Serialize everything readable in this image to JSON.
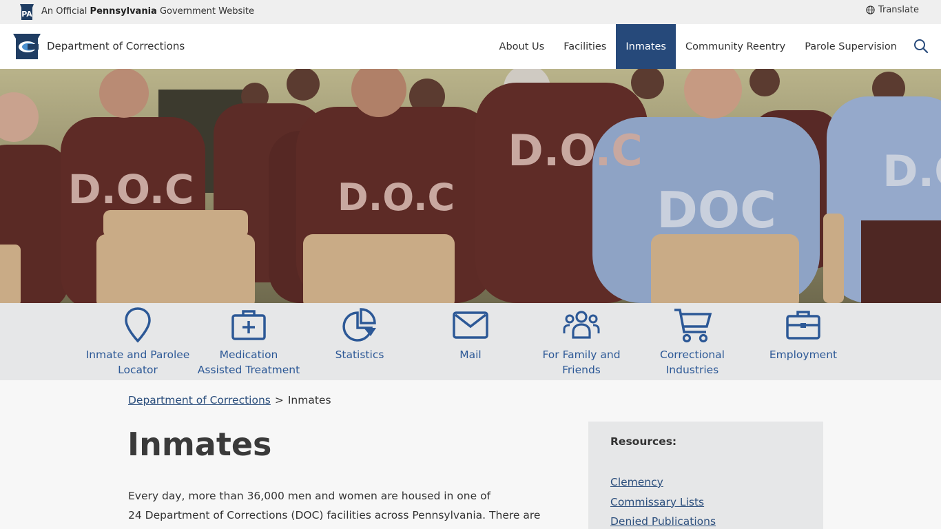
{
  "banner": {
    "official_prefix": "An Official ",
    "official_state": "Pennsylvania",
    "official_suffix": " Government Website",
    "badge_text": "PA",
    "translate": "Translate"
  },
  "header": {
    "department": "Department of Corrections",
    "nav": [
      {
        "label": "About Us"
      },
      {
        "label": "Facilities"
      },
      {
        "label": "Inmates",
        "active": true
      },
      {
        "label": "Community Reentry"
      },
      {
        "label": "Parole Supervision"
      }
    ]
  },
  "hero": {
    "shirt_labels": [
      "D.O.C",
      "D.O.C",
      "D.O.C",
      "DOC",
      "D.O"
    ]
  },
  "quicklinks": [
    {
      "line1": "Inmate and Parolee",
      "line2": "Locator",
      "icon": "map-pin-icon"
    },
    {
      "line1": "Medication",
      "line2": "Assisted Treatment",
      "icon": "medical-kit-icon"
    },
    {
      "line1": "Statistics",
      "line2": "",
      "icon": "pie-chart-icon"
    },
    {
      "line1": "Mail",
      "line2": "",
      "icon": "envelope-icon"
    },
    {
      "line1": "For Family and",
      "line2": "Friends",
      "icon": "people-icon"
    },
    {
      "line1": "Correctional",
      "line2": "Industries",
      "icon": "shopping-cart-icon"
    },
    {
      "line1": "Employment",
      "line2": "",
      "icon": "briefcase-icon"
    }
  ],
  "breadcrumb": {
    "home": "Department of Corrections",
    "separator": ">",
    "current": "Inmates"
  },
  "main": {
    "title": "Inmates",
    "intro_line1": "Every day, more than 36,000 men and women are housed in one of",
    "intro_line2": "24 Department of Corrections (DOC) facilities across Pennsylvania. There are"
  },
  "resources": {
    "title": "Resources:",
    "links": [
      "Clemency",
      "Commissary Lists",
      "Denied Publications"
    ]
  },
  "colors": {
    "nav_active": "#26497a",
    "link": "#2c4f7d",
    "icon_blue": "#2c5896",
    "panel_gray": "#e6e7e8"
  }
}
